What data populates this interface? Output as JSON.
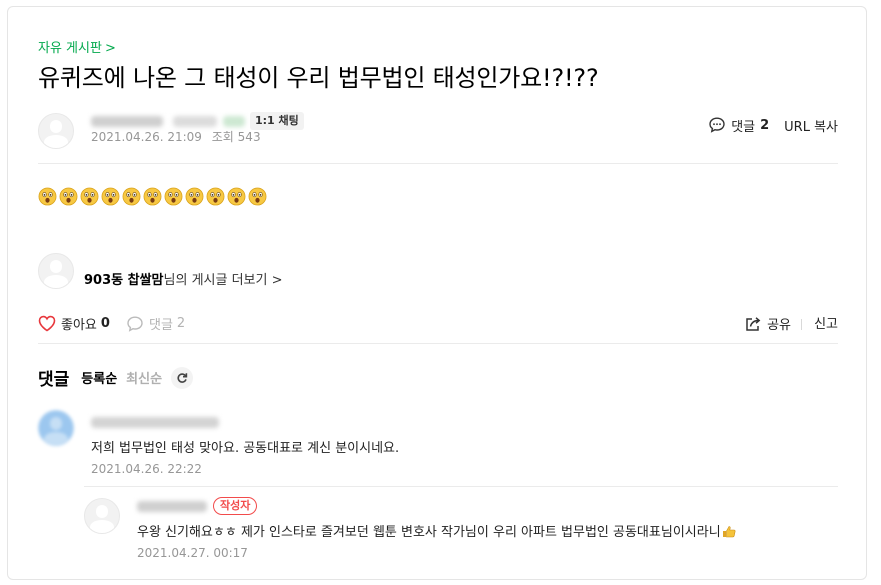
{
  "board": {
    "name": "자유 게시판",
    "chevron": ">"
  },
  "post": {
    "title": "유퀴즈에 나온 그 태성이 우리 법무법인 태성인가요!?!??",
    "chat_label": "1:1 채팅",
    "date": "2021.04.26. 21:09",
    "views_label": "조회",
    "views": "543",
    "comment_label": "댓글",
    "comment_count": "2",
    "url_copy": "URL 복사",
    "emoji_name": "astonished-face-icon",
    "emoji_count": 11
  },
  "author_more": {
    "name": "903동 찹쌀맘",
    "suffix": "님의 게시글 더보기",
    "chevron": ">"
  },
  "reactions": {
    "like_label": "좋아요",
    "like_count": "0",
    "comment_label": "댓글",
    "comment_count": "2",
    "share_label": "공유",
    "report_label": "신고"
  },
  "comments_section": {
    "title": "댓글",
    "sort_options": [
      "등록순",
      "최신순"
    ],
    "active_sort": "등록순"
  },
  "comments": [
    {
      "text": "저희 법무법인 태성 맞아요. 공동대표로 계신 분이시네요.",
      "date": "2021.04.26. 22:22"
    },
    {
      "badge": "작성자",
      "text": "우왕 신기해요ㅎㅎ 제가 인스타로 즐겨보던 웹툰 변호사 작가님이 우리 아파트 법무법인 공동대표님이시라니",
      "date": "2021.04.27. 00:17"
    }
  ],
  "colors": {
    "accent": "#03a94d",
    "like": "#e8383d",
    "badge": "#f24b4b",
    "meta": "#979797"
  }
}
